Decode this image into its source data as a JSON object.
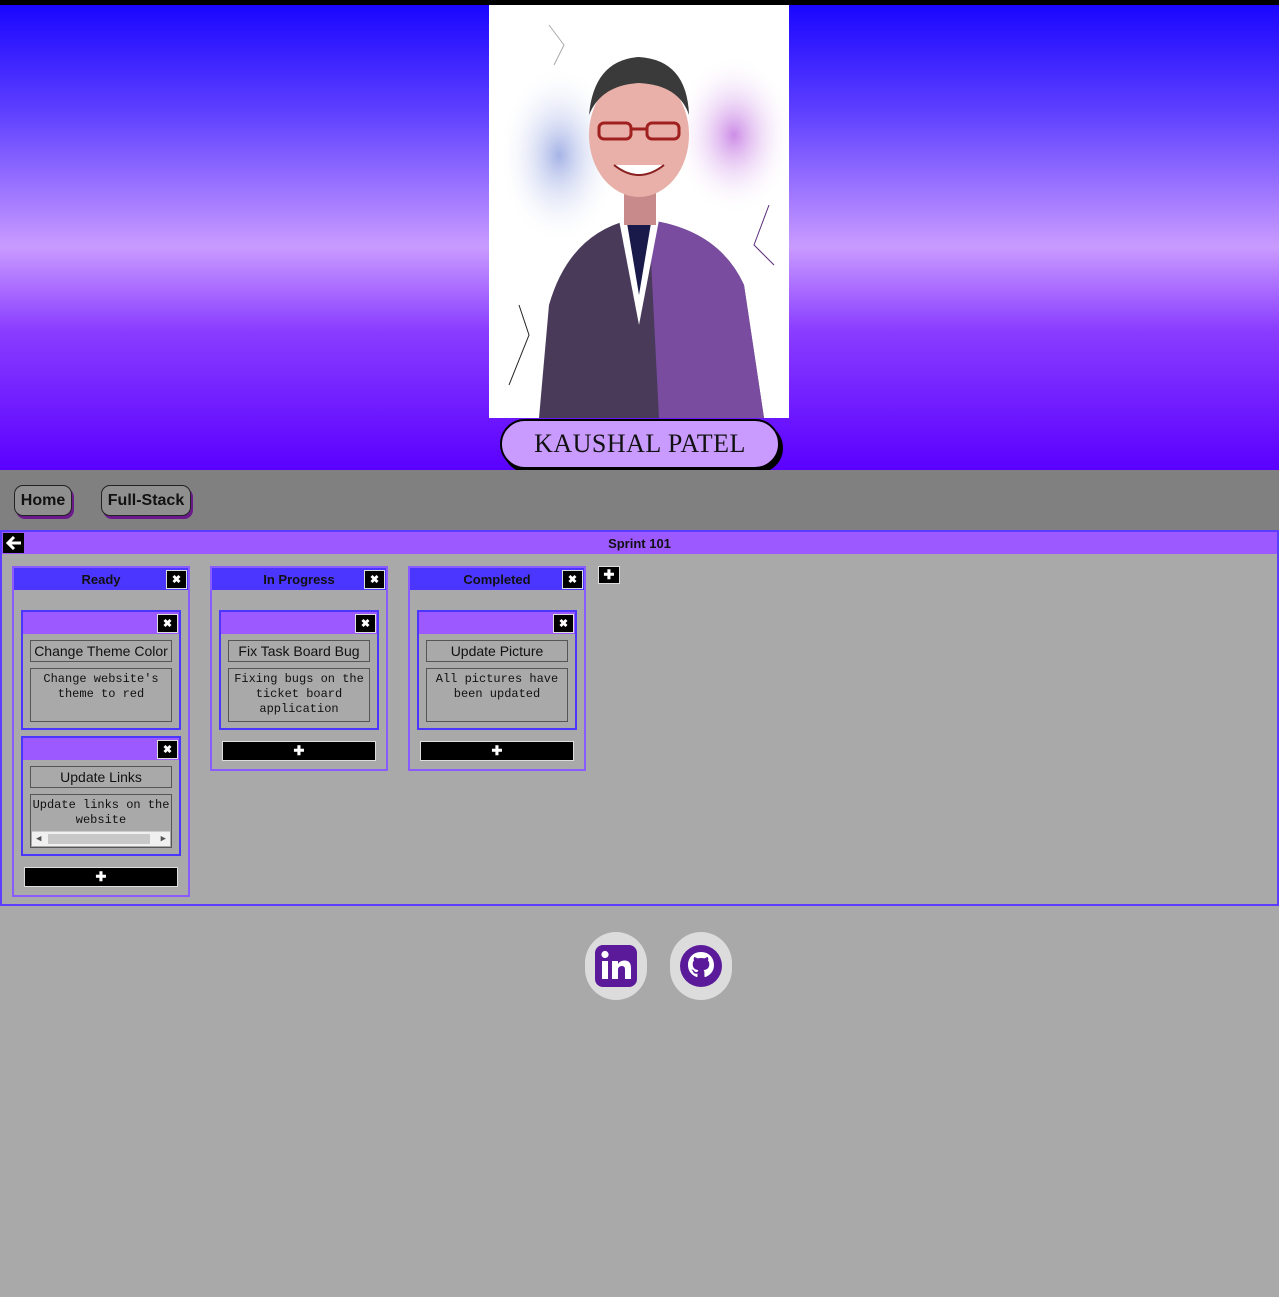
{
  "header": {
    "name": "KAUSHAL PATEL"
  },
  "nav": {
    "items": [
      {
        "label": "Home"
      },
      {
        "label": "Full-Stack"
      }
    ]
  },
  "board": {
    "title": "Sprint 101",
    "back_icon": "arrow-left-icon",
    "add_column_icon": "plus-icon",
    "columns": [
      {
        "title": "Ready",
        "cards": [
          {
            "title": "Change Theme Color",
            "description": "Change website's theme to red"
          },
          {
            "title": "Update Links",
            "description": "Update links on the website"
          }
        ]
      },
      {
        "title": "In Progress",
        "cards": [
          {
            "title": "Fix Task Board Bug",
            "description": "Fixing bugs on the ticket board application"
          }
        ]
      },
      {
        "title": "Completed",
        "cards": [
          {
            "title": "Update Picture",
            "description": "All pictures have been updated"
          }
        ]
      }
    ]
  },
  "footer": {
    "links": [
      {
        "icon": "linkedin-icon"
      },
      {
        "icon": "github-icon"
      }
    ]
  },
  "colors": {
    "accent": "#4a36ff",
    "card_header": "#9b59ff",
    "name_pill": "#c99bff",
    "page_bg": "#a9a9a9",
    "nav_bg": "#808080",
    "icon_purple": "#5a1a9a"
  }
}
